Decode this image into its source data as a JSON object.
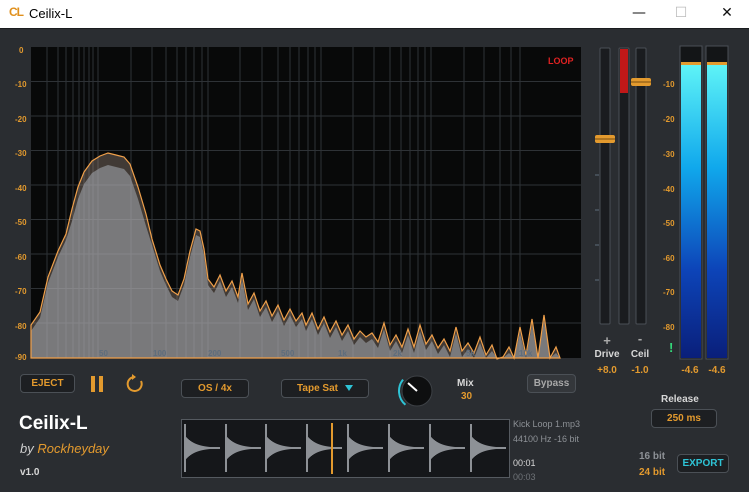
{
  "window": {
    "app_icon": "CL",
    "title": "Ceilix-L",
    "minimize_glyph": "—",
    "maximize_glyph": "☐",
    "close_glyph": "✕"
  },
  "spectrum": {
    "loop_label": "LOOP",
    "db_labels": [
      "0",
      "-10",
      "-20",
      "-30",
      "-40",
      "-50",
      "-60",
      "-70",
      "-80",
      "-90"
    ],
    "freq_labels": [
      "50",
      "100",
      "200",
      "500",
      "1k",
      "2k",
      "5k",
      "10k"
    ],
    "db_range": [
      -90,
      0
    ]
  },
  "faders": {
    "drive": {
      "sign": "+",
      "label": "Drive",
      "value": "+8.0"
    },
    "ceil": {
      "sign": "-",
      "label": "Ceil",
      "value": "-1.0"
    }
  },
  "meters": {
    "scale": [
      "-10",
      "-20",
      "-30",
      "-40",
      "-50",
      "-60",
      "-70",
      "-80"
    ],
    "warning": "!",
    "left_value": "-4.6",
    "right_value": "-4.6"
  },
  "transport": {
    "eject_label": "EJECT",
    "pause_icon": "pause-icon",
    "loop_icon": "loop-icon"
  },
  "controls": {
    "oversampling_label": "OS / 4x",
    "saturation_label": "Tape Sat",
    "mix_label": "Mix",
    "mix_value": "30",
    "bypass_label": "Bypass",
    "release_label": "Release",
    "release_value": "250 ms",
    "bit_16": "16 bit",
    "bit_24": "24 bit",
    "export_label": "EXPORT"
  },
  "plugin": {
    "name": "Ceilix-L",
    "by": "by",
    "author": "Rockheyday",
    "version": "v1.0"
  },
  "file": {
    "name": "Kick Loop 1.mp3",
    "format": "44100 Hz -16 bit",
    "time_current": "00:01",
    "time_total": "00:03"
  },
  "colors": {
    "accent_orange": "#e39a2e",
    "accent_cyan": "#2ec4d6",
    "loop_red": "#e02222",
    "background": "#2a2d31"
  }
}
